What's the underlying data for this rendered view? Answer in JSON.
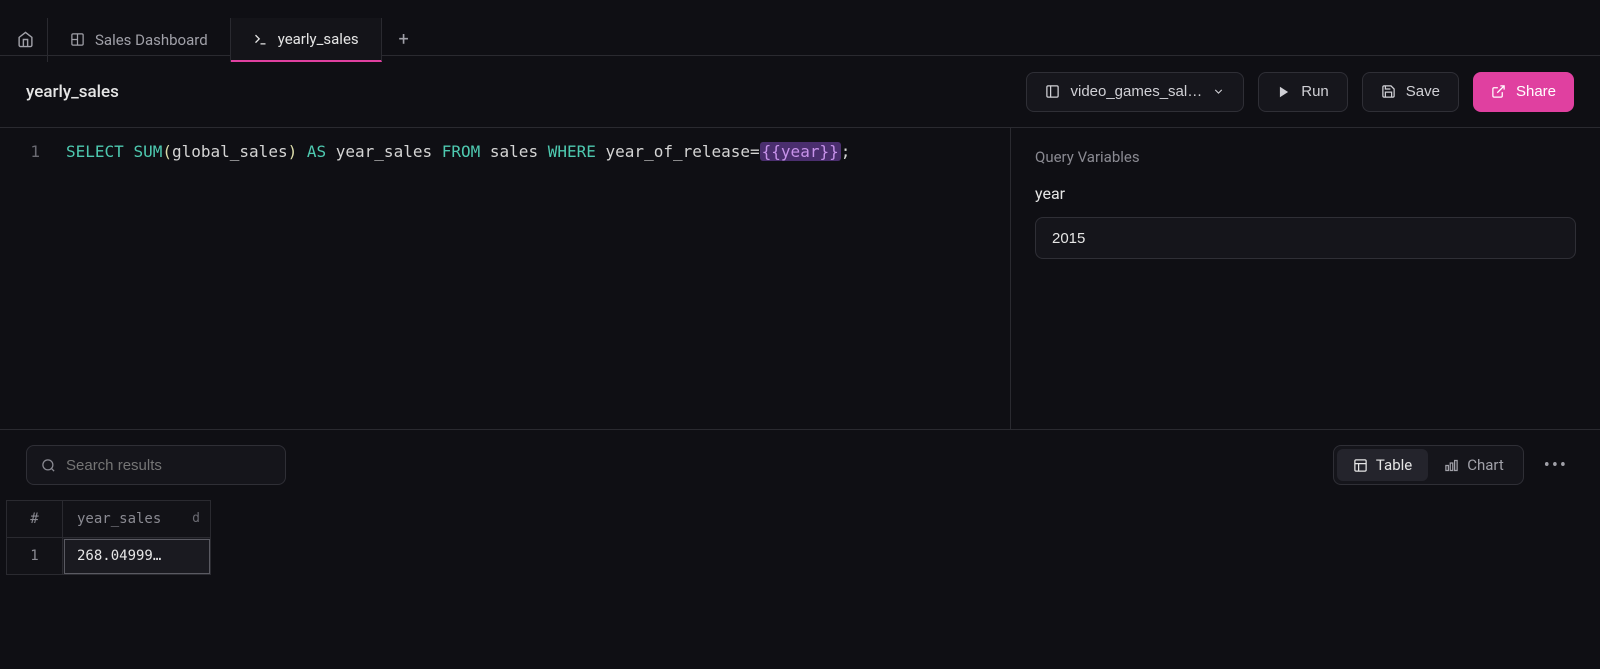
{
  "tabs": {
    "dashboard_label": "Sales Dashboard",
    "query_label": "yearly_sales"
  },
  "query": {
    "title": "yearly_sales",
    "line_number": "1",
    "sql": {
      "select": "SELECT",
      "sum": "SUM",
      "lparen": "(",
      "col": "global_sales",
      "rparen": ")",
      "as": "AS",
      "alias": "year_sales",
      "from": "FROM",
      "table": "sales",
      "where": "WHERE",
      "cond_col": "year_of_release=",
      "var": "{{year}}",
      "semi": ";"
    }
  },
  "toolbar": {
    "database_label": "video_games_sal…",
    "run_label": "Run",
    "save_label": "Save",
    "share_label": "Share"
  },
  "variables": {
    "section_title": "Query Variables",
    "items": [
      {
        "name": "year",
        "value": "2015"
      }
    ]
  },
  "results": {
    "search_placeholder": "Search results",
    "view_table_label": "Table",
    "view_chart_label": "Chart",
    "columns": [
      {
        "name": "year_sales",
        "type": "d"
      }
    ],
    "rows": [
      {
        "index": "1",
        "cells": [
          "268.04999…"
        ]
      }
    ],
    "index_header": "#"
  }
}
